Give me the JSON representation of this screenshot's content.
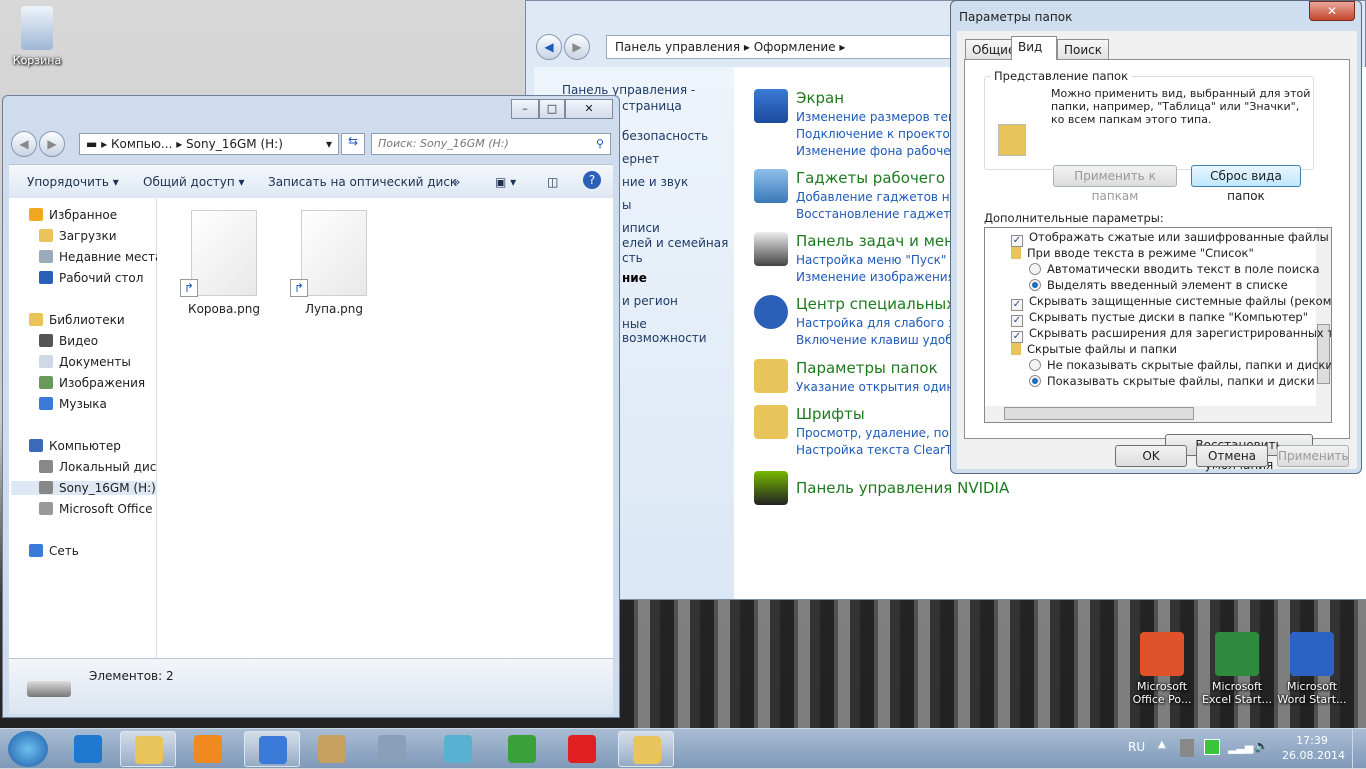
{
  "desktop": {
    "icons": [
      {
        "label": "Корзина",
        "icon": "recycle-bin-icon"
      },
      {
        "label": "Microsoft Office Po...",
        "icon": "powerpoint-icon",
        "color": "#e0522a"
      },
      {
        "label": "Microsoft Excel Start...",
        "icon": "excel-icon",
        "color": "#2e8b3e"
      },
      {
        "label": "Microsoft Word Start...",
        "icon": "word-icon",
        "color": "#2b62c4"
      }
    ]
  },
  "control_panel": {
    "breadcrumb": [
      "Панель управления",
      "Оформление"
    ],
    "left_links": [
      "Панель управления -",
      "страница",
      "безопасность",
      "ернет",
      "ние и звук",
      "ы",
      "иписи",
      "елей и семейная",
      "сть",
      "ние",
      "и регион",
      "ные возможности"
    ],
    "categories": [
      {
        "title": "Экран",
        "links": [
          "Изменение размеров текста",
          "Подключение к проектору",
          "Изменение фона рабочего"
        ],
        "icon": "display-icon"
      },
      {
        "title": "Гаджеты рабочего сто",
        "links": [
          "Добавление гаджетов на ра",
          "Восстановление гаджетов р"
        ],
        "icon": "gadgets-icon"
      },
      {
        "title": "Панель задач и меню",
        "links": [
          "Настройка меню \"Пуск\"",
          "Изменение изображения в"
        ],
        "icon": "taskbar-icon"
      },
      {
        "title": "Центр специальных в",
        "links": [
          "Настройка для слабого зрен",
          "Включение клавиш удобно"
        ],
        "icon": "accessibility-icon"
      },
      {
        "title": "Параметры папок",
        "links": [
          "Указание открытия одиноч"
        ],
        "icon": "folder-options-icon"
      },
      {
        "title": "Шрифты",
        "links": [
          "Просмотр, удаление, показ",
          "Настройка текста ClearType"
        ],
        "icon": "fonts-icon"
      },
      {
        "title": "Панель управления NVIDIA",
        "links": [],
        "icon": "nvidia-icon"
      }
    ]
  },
  "explorer": {
    "address": [
      "Компью...",
      "Sony_16GM (H:)"
    ],
    "search_placeholder": "Поиск: Sony_16GM (H:)",
    "toolbar": {
      "organize": "Упорядочить",
      "share": "Общий доступ",
      "burn": "Записать на оптический диск",
      "more": "»"
    },
    "nav": [
      {
        "label": "Избранное",
        "level": 0,
        "icon": "star-icon"
      },
      {
        "label": "Загрузки",
        "level": 1,
        "icon": "downloads-icon"
      },
      {
        "label": "Недавние места",
        "level": 1,
        "icon": "recent-places-icon"
      },
      {
        "label": "Рабочий стол",
        "level": 1,
        "icon": "desktop-icon"
      },
      {
        "label": "Библиотеки",
        "level": 0,
        "icon": "libraries-icon"
      },
      {
        "label": "Видео",
        "level": 1,
        "icon": "video-icon"
      },
      {
        "label": "Документы",
        "level": 1,
        "icon": "documents-icon"
      },
      {
        "label": "Изображения",
        "level": 1,
        "icon": "pictures-icon"
      },
      {
        "label": "Музыка",
        "level": 1,
        "icon": "music-icon"
      },
      {
        "label": "Компьютер",
        "level": 0,
        "icon": "computer-icon"
      },
      {
        "label": "Локальный диск",
        "level": 1,
        "icon": "local-disk-icon"
      },
      {
        "label": "Sony_16GM (H:)",
        "level": 1,
        "icon": "usb-drive-icon",
        "selected": true
      },
      {
        "label": "Microsoft Office C",
        "level": 1,
        "icon": "drive-icon"
      },
      {
        "label": "Сеть",
        "level": 0,
        "icon": "network-icon"
      }
    ],
    "files": [
      {
        "name": "Корова.png"
      },
      {
        "name": "Лупа.png"
      }
    ],
    "status": "Элементов: 2"
  },
  "dialog": {
    "title": "Параметры папок",
    "tabs": [
      {
        "label": "Общие"
      },
      {
        "label": "Вид",
        "active": true
      },
      {
        "label": "Поиск"
      }
    ],
    "group_title": "Представление папок",
    "group_text": [
      "Можно применить вид, выбранный для этой",
      "папки, например, \"Таблица\" или \"Значки\",",
      "ко всем папкам этого типа."
    ],
    "apply_to_folders": "Применить к папкам",
    "reset_folders": "Сброс вида папок",
    "advanced_label": "Дополнительные параметры:",
    "options": [
      {
        "type": "checkbox",
        "checked": true,
        "label": "Отображать сжатые или зашифрованные файлы NTI"
      },
      {
        "type": "folder",
        "label": "При вводе текста в режиме \"Список\""
      },
      {
        "type": "radio",
        "checked": false,
        "label": "Автоматически вводить текст в поле поиска"
      },
      {
        "type": "radio",
        "checked": true,
        "label": "Выделять введенный элемент в списке"
      },
      {
        "type": "checkbox",
        "checked": true,
        "label": "Скрывать защищенные системные файлы (рекомен,"
      },
      {
        "type": "checkbox",
        "checked": true,
        "label": "Скрывать пустые диски в папке \"Компьютер\""
      },
      {
        "type": "checkbox",
        "checked": true,
        "label": "Скрывать расширения для зарегистрированных типо"
      },
      {
        "type": "folder",
        "label": "Скрытые файлы и папки"
      },
      {
        "type": "radio",
        "checked": false,
        "label": "Не показывать скрытые файлы, папки и диски"
      },
      {
        "type": "radio",
        "checked": true,
        "label": "Показывать скрытые файлы, папки и диски"
      }
    ],
    "restore_defaults": "Восстановить умолчания",
    "ok": "OK",
    "cancel": "Отмена",
    "apply": "Применить"
  },
  "taskbar": {
    "items": [
      "ie-icon",
      "explorer-icon",
      "media-player-icon",
      "control-panel-icon",
      "paint-icon",
      "calculator-icon",
      "notepad-icon",
      "download-icon",
      "yandex-icon",
      "folder-options-icon"
    ],
    "lang": "RU",
    "time": "17:39",
    "date": "26.08.2014"
  }
}
